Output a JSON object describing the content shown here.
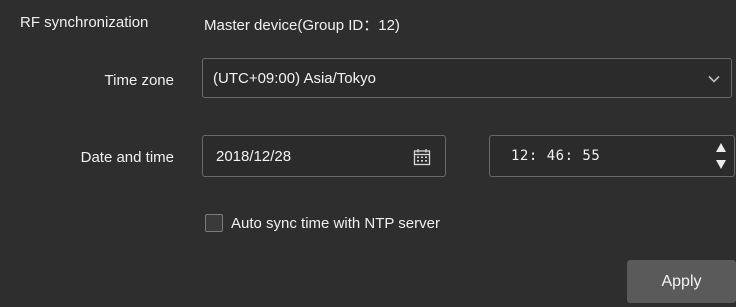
{
  "rf_sync": {
    "label": "RF synchronization",
    "value": "Master device(Group ID：12)"
  },
  "time_zone": {
    "label": "Time zone",
    "selected": "(UTC+09:00) Asia/Tokyo",
    "icon": "chevron-down-icon"
  },
  "date_time": {
    "label": "Date and time",
    "date": "2018/12/28",
    "date_icon": "calendar-icon",
    "time": "12: 46: 55",
    "time_icon": "spinner-arrows-icon"
  },
  "ntp": {
    "checked": false,
    "label": "Auto sync time with NTP server"
  },
  "actions": {
    "apply_label": "Apply"
  },
  "colors": {
    "background": "#2e2e2e",
    "field_border": "#6a6a6a",
    "button_bg": "#5a5a5a",
    "text": "#f0f0f0"
  }
}
